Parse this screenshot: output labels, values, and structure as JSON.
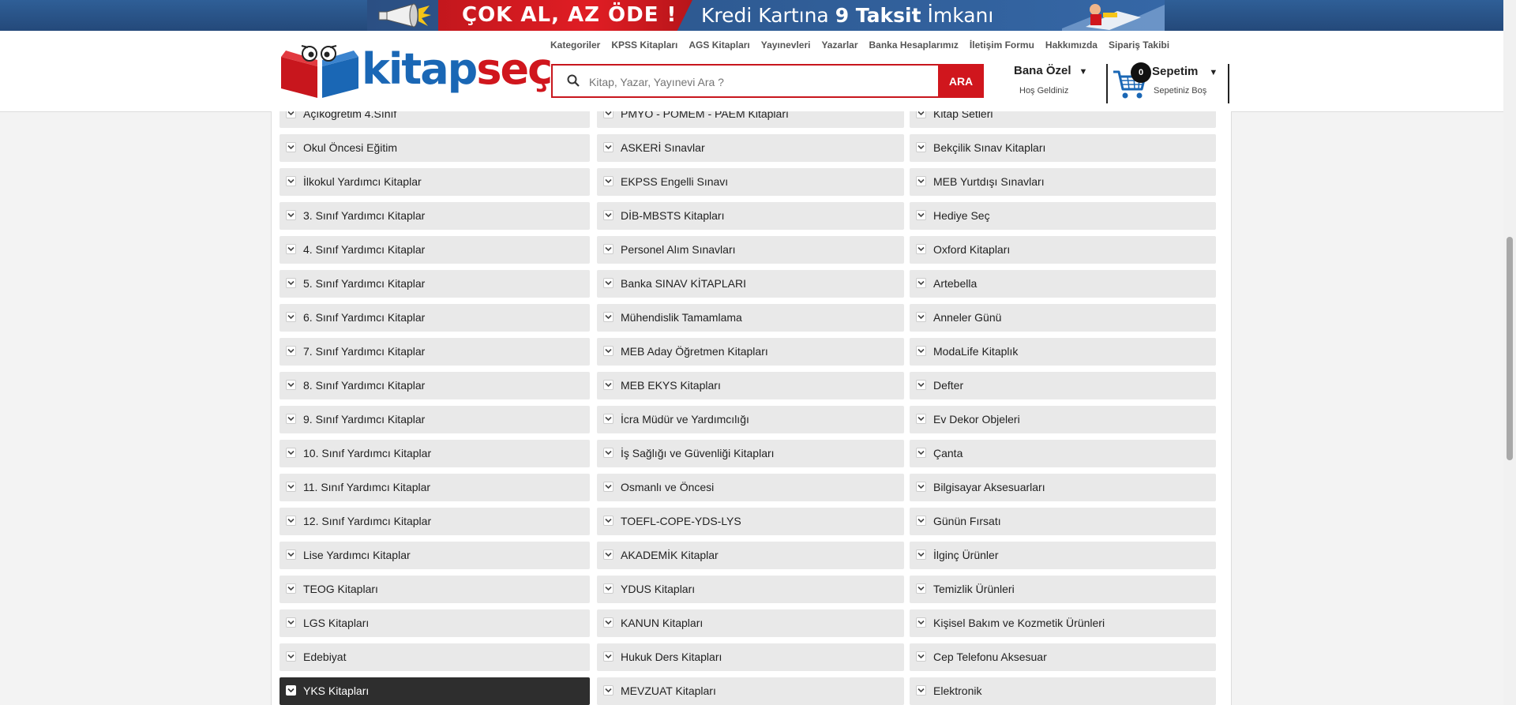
{
  "banner": {
    "text_left": "ÇOK AL, AZ ÖDE !",
    "text_right_a": "Kredi Kartına ",
    "text_right_num": "9",
    "text_right_b": " Taksit",
    "text_right_c": " İmkanı"
  },
  "header": {
    "nav": [
      "Kategoriler",
      "KPSS Kitapları",
      "AGS Kitapları",
      "Yayınevleri",
      "Yazarlar",
      "Banka Hesaplarımız",
      "İletişim Formu",
      "Hakkımızda",
      "Sipariş Takibi"
    ],
    "search": {
      "placeholder": "Kitap, Yazar, Yayınevi Ara ?",
      "button": "ARA"
    },
    "account": {
      "title": "Bana Özel",
      "subtitle": "Hoş Geldiniz"
    },
    "cart": {
      "count": "0",
      "title": "Sepetim",
      "subtitle": "Sepetiniz Boş"
    }
  },
  "categories": {
    "col1": [
      "Açıköğretim 4.Sınıf",
      "Okul Öncesi Eğitim",
      "İlkokul Yardımcı Kitaplar",
      "3. Sınıf Yardımcı Kitaplar",
      "4. Sınıf Yardımcı Kitaplar",
      "5. Sınıf Yardımcı Kitaplar",
      "6. Sınıf Yardımcı Kitaplar",
      "7. Sınıf Yardımcı Kitaplar",
      "8. Sınıf Yardımcı Kitaplar",
      "9. Sınıf Yardımcı Kitaplar",
      "10. Sınıf Yardımcı Kitaplar",
      "11. Sınıf Yardımcı Kitaplar",
      "12. Sınıf Yardımcı Kitaplar",
      "Lise Yardımcı Kitaplar",
      "TEOG Kitapları",
      "LGS Kitapları",
      "Edebiyat",
      "YKS Kitapları"
    ],
    "col2": [
      "PMYO - POMEM - PAEM Kitapları",
      "ASKERİ Sınavlar",
      "EKPSS Engelli Sınavı",
      "DİB-MBSTS Kitapları",
      "Personel Alım Sınavları",
      "Banka SINAV KİTAPLARI",
      "Mühendislik Tamamlama",
      "MEB Aday Öğretmen Kitapları",
      "MEB EKYS Kitapları",
      "İcra Müdür ve Yardımcılığı",
      "İş Sağlığı ve Güvenliği Kitapları",
      "Osmanlı ve Öncesi",
      "TOEFL-COPE-YDS-LYS",
      "AKADEMİK Kitaplar",
      "YDUS Kitapları",
      "KANUN Kitapları",
      "Hukuk Ders Kitapları",
      "MEVZUAT Kitapları"
    ],
    "col3": [
      "Kitap Setleri",
      "Bekçilik Sınav Kitapları",
      "MEB Yurtdışı Sınavları",
      "Hediye Seç",
      "Oxford Kitapları",
      "Artebella",
      "Anneler Günü",
      "ModaLife Kitaplık",
      "Defter",
      "Ev Dekor Objeleri",
      "Çanta",
      "Bilgisayar Aksesuarları",
      "Günün Fırsatı",
      "İlginç Ürünler",
      "Temizlik Ürünleri",
      "Kişisel Bakım ve Kozmetik Ürünleri",
      "Cep Telefonu Aksesuar",
      "Elektronik"
    ],
    "active": "YKS Kitapları"
  }
}
